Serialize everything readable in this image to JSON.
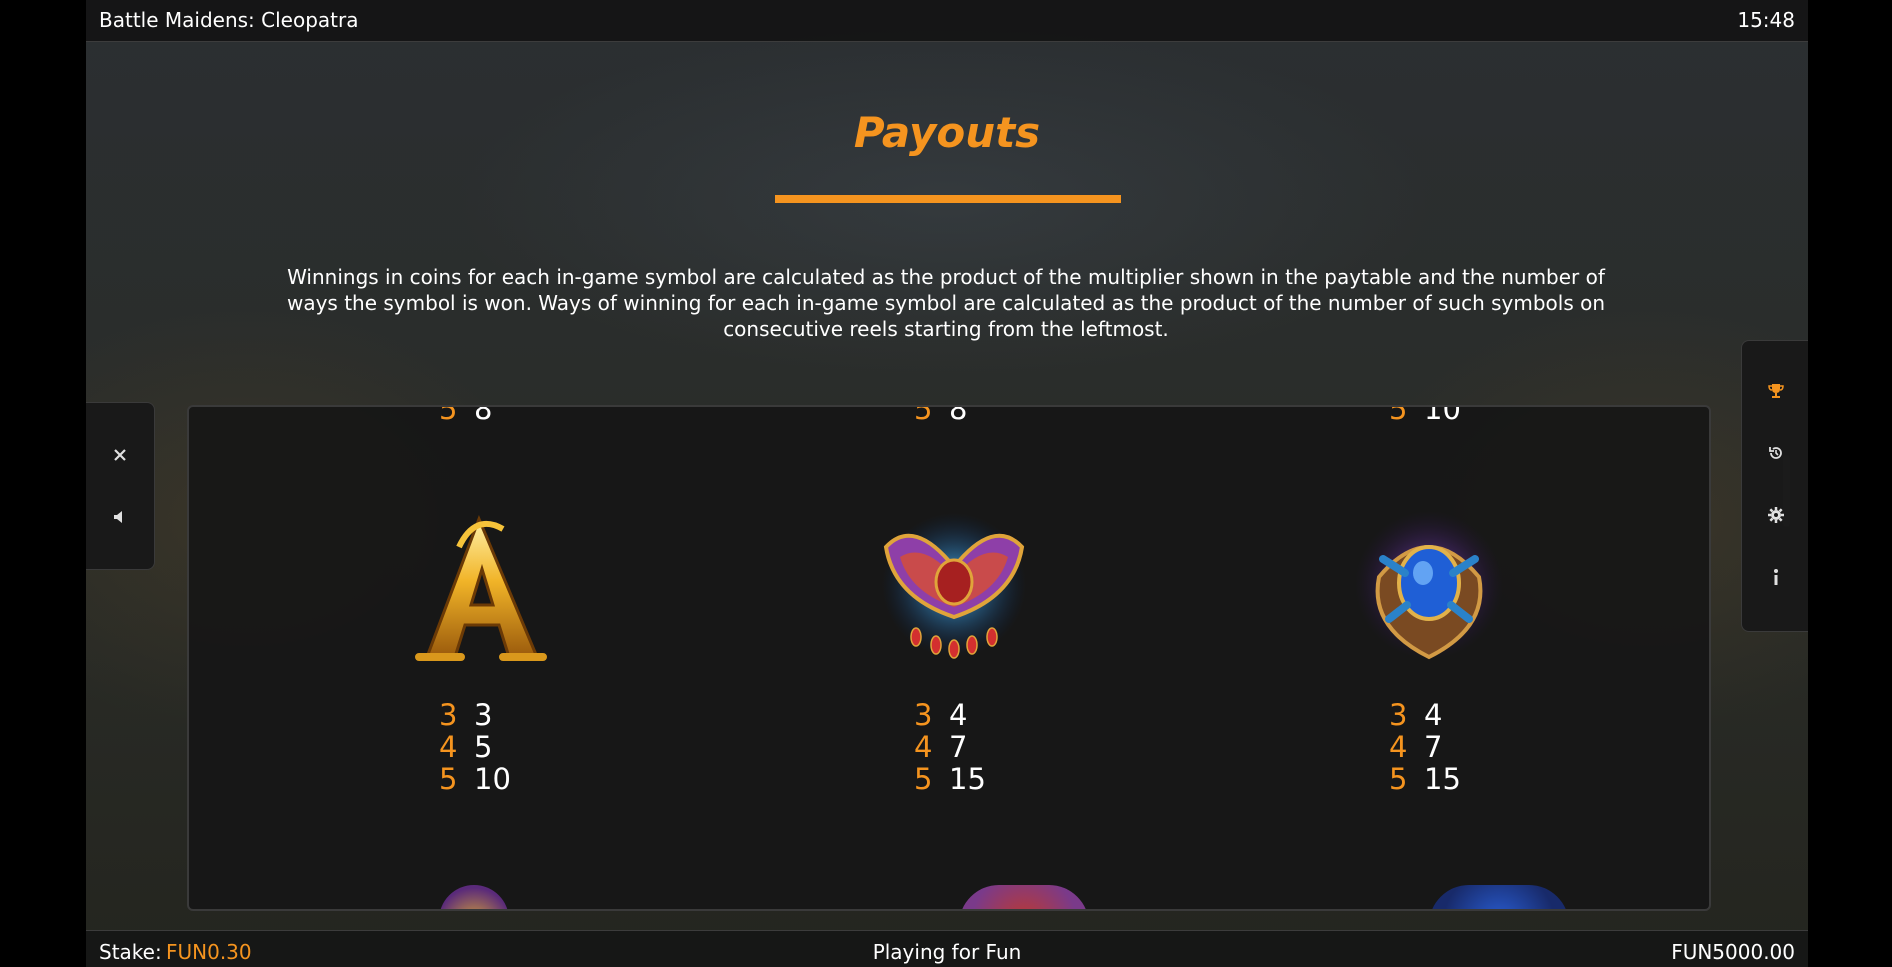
{
  "header": {
    "title": "Battle Maidens: Cleopatra",
    "clock": "15:48"
  },
  "content": {
    "heading": "Payouts",
    "description": "Winnings in coins for each in-game symbol are calculated as the product of the multiplier shown in the paytable and the number of ways the symbol is won. Ways of winning for each in-game symbol are calculated as the product of the number of such symbols on consecutive reels starting from the leftmost."
  },
  "paytable": [
    {
      "symbol": "letter-a-symbol",
      "payouts": [
        {
          "count": "3",
          "amount": "3"
        },
        {
          "count": "4",
          "amount": "5"
        },
        {
          "count": "5",
          "amount": "10"
        }
      ]
    },
    {
      "symbol": "winged-scarab-necklace-symbol",
      "payouts": [
        {
          "count": "3",
          "amount": "4"
        },
        {
          "count": "4",
          "amount": "7"
        },
        {
          "count": "5",
          "amount": "15"
        }
      ]
    },
    {
      "symbol": "scarab-ring-symbol",
      "payouts": [
        {
          "count": "3",
          "amount": "4"
        },
        {
          "count": "4",
          "amount": "7"
        },
        {
          "count": "5",
          "amount": "15"
        }
      ]
    }
  ],
  "partial_top_row": [
    {
      "count": "5",
      "amount": "8"
    },
    {
      "count": "5",
      "amount": "8"
    },
    {
      "count": "5",
      "amount": "10"
    }
  ],
  "side_controls": {
    "left": [
      "close-icon",
      "sound-icon"
    ],
    "right": [
      "trophy-icon",
      "history-icon",
      "gear-icon",
      "info-icon"
    ]
  },
  "footer": {
    "stake_label": "Stake:",
    "stake_value": "FUN0.30",
    "mode": "Playing for Fun",
    "balance": "FUN5000.00"
  },
  "colors": {
    "accent": "#f5941f",
    "background": "#000000",
    "panel": "#161616"
  }
}
